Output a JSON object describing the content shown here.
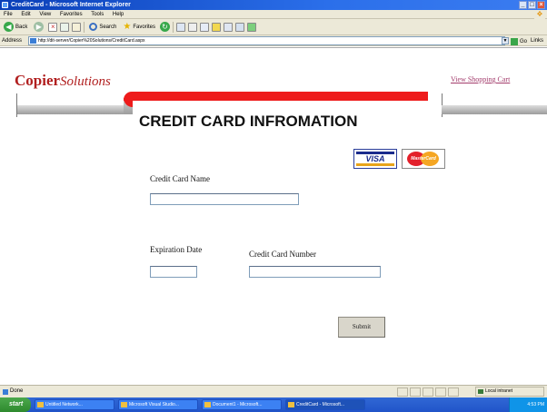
{
  "window": {
    "title": "CreditCard - Microsoft Internet Explorer"
  },
  "menu": {
    "items": [
      "File",
      "Edit",
      "View",
      "Favorites",
      "Tools",
      "Help"
    ]
  },
  "toolbar": {
    "back": "Back",
    "search": "Search",
    "favorites": "Favorites"
  },
  "address": {
    "label": "Address",
    "url": "http://dit-server/Copier%20Solutions/CreditCard.aspx",
    "go": "Go",
    "links": "Links"
  },
  "page": {
    "logo_main": "Copier",
    "logo_sub": "Solutions",
    "cart_link": "View Shopping Cart",
    "heading": "CREDIT CARD INFROMATION",
    "cards": {
      "visa": "VISA",
      "mastercard": "MasterCard"
    },
    "fields": {
      "name_label": "Credit Card Name",
      "name_value": "",
      "exp_label": "Expiration Date",
      "exp_value": "",
      "number_label": "Credit Card Number",
      "number_value": ""
    },
    "submit": "Submit"
  },
  "status": {
    "left": "Done",
    "zone": "Local intranet"
  },
  "taskbar": {
    "start": "start",
    "tasks": [
      "Untitled Network...",
      "Microsoft Visual Studio...",
      "Document1 - Microsoft...",
      "CreditCard - Microsoft..."
    ],
    "clock": "4:53 PM"
  },
  "colors": {
    "accent_red": "#ee1b1b",
    "logo_red": "#b11f1f",
    "link": "#a23b6b",
    "xp_blue": "#2b6fea"
  }
}
